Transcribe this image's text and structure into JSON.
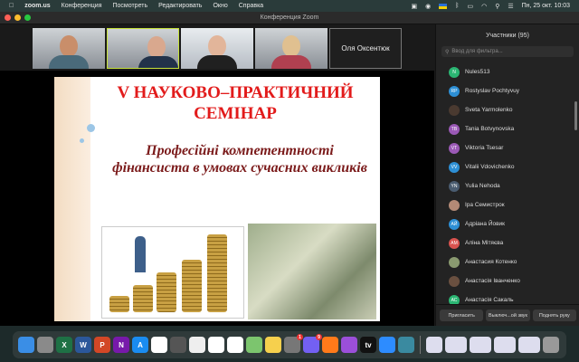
{
  "menubar": {
    "apple": "",
    "app": "zoom.us",
    "items": [
      "Конференция",
      "Посмотреть",
      "Редактировать",
      "Окно",
      "Справка"
    ],
    "datetime": "Пн, 25 окт. 10:03"
  },
  "window": {
    "title": "Конференция Zoom"
  },
  "videos": {
    "name_tile": "Оля Оксентюк"
  },
  "slide": {
    "title": "V НАУКОВО–ПРАКТИЧНИЙ СЕМІНАР",
    "subtitle": "Професійні компетентності фінансиста в умовах сучасних викликів"
  },
  "participants": {
    "title": "Участники (95)",
    "filter_placeholder": "Ввод для фильтра...",
    "items": [
      {
        "initials": "N",
        "name": "Nules513",
        "color": "#2bb673"
      },
      {
        "initials": "RP",
        "name": "Rostyslav Pochtyvuy",
        "color": "#2d8fd5"
      },
      {
        "initials": "",
        "name": "Sveta Yarmolenko",
        "color": "#4a3a30"
      },
      {
        "initials": "TB",
        "name": "Tania Botvynovska",
        "color": "#9b59b6"
      },
      {
        "initials": "VT",
        "name": "Viktoria Tsesar",
        "color": "#9b59b6"
      },
      {
        "initials": "VV",
        "name": "Vitalii Vdovichenko",
        "color": "#2d8fd5"
      },
      {
        "initials": "YN",
        "name": "Yulia Nehoda",
        "color": "#4a5c70"
      },
      {
        "initials": "",
        "name": "Іра Семистрок",
        "color": "#b48a76"
      },
      {
        "initials": "АЙ",
        "name": "Адріана Йовик",
        "color": "#2d8fd5"
      },
      {
        "initials": "АМ",
        "name": "Аліна Мітяєва",
        "color": "#d9534f"
      },
      {
        "initials": "",
        "name": "Анастасия Котенко",
        "color": "#8a9a70"
      },
      {
        "initials": "",
        "name": "Анастасія Іванченко",
        "color": "#6a5040"
      },
      {
        "initials": "АС",
        "name": "Анастасія Сакаль",
        "color": "#2bb673"
      }
    ],
    "buttons": {
      "invite": "Пригласить",
      "mute_all": "Выключ...ой звук",
      "raise_hand": "Поднять руку"
    }
  },
  "dock": {
    "apps": [
      "finder",
      "launchpad",
      "excel",
      "word",
      "powerpoint",
      "onenote",
      "app-store",
      "onedrive",
      "calculator",
      "chrome",
      "photos",
      "reminders",
      "maps",
      "notes",
      "system-preferences",
      "viber",
      "firefox",
      "podcasts",
      "apple-tv",
      "zoom",
      "webcam"
    ],
    "badges": {
      "system-preferences": "1",
      "viber": "9"
    },
    "tv_label": "tv"
  }
}
